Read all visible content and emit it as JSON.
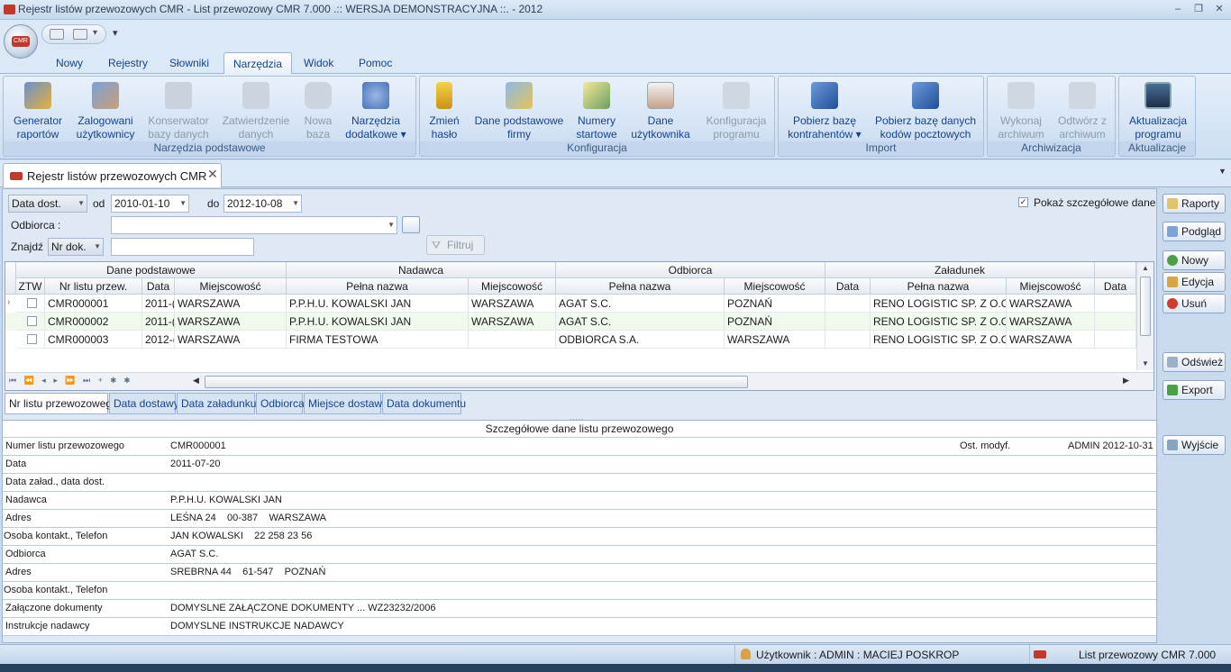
{
  "window": {
    "title": "Rejestr listów przewozowych CMR - List przewozowy CMR 7.000 .:: WERSJA DEMONSTRACYJNA ::. - 2012",
    "minimize": "–",
    "maximize": "❐",
    "close": "✕"
  },
  "orb_label": "CMR",
  "qat_more": "▾",
  "ribbon_tabs": [
    "Nowy",
    "Rejestry",
    "Słowniki",
    "Narzędzia",
    "Widok",
    "Pomoc"
  ],
  "ribbon": {
    "groups": [
      {
        "label": "Narzędzia podstawowe",
        "buttons": [
          {
            "l1": "Generator",
            "l2": "raportów"
          },
          {
            "l1": "Zalogowani",
            "l2": "użytkownicy"
          },
          {
            "l1": "Konserwator",
            "l2": "bazy danych"
          },
          {
            "l1": "Zatwierdzenie",
            "l2": "danych"
          },
          {
            "l1": "Nowa",
            "l2": "baza"
          },
          {
            "l1": "Narzędzia",
            "l2": "dodatkowe ▾"
          }
        ]
      },
      {
        "label": "Konfiguracja",
        "buttons": [
          {
            "l1": "Zmień",
            "l2": "hasło"
          },
          {
            "l1": "Dane podstawowe",
            "l2": "firmy"
          },
          {
            "l1": "Numery",
            "l2": "startowe"
          },
          {
            "l1": "Dane",
            "l2": "użytkownika"
          },
          {
            "l1": "Konfiguracja",
            "l2": "programu"
          }
        ]
      },
      {
        "label": "Import",
        "buttons": [
          {
            "l1": "Pobierz bazę",
            "l2": "kontrahentów ▾"
          },
          {
            "l1": "Pobierz bazę danych",
            "l2": "kodów pocztowych"
          }
        ]
      },
      {
        "label": "Archiwizacja",
        "buttons": [
          {
            "l1": "Wykonaj",
            "l2": "archiwum"
          },
          {
            "l1": "Odtwórz z",
            "l2": "archiwum"
          }
        ]
      },
      {
        "label": "Aktualizacje",
        "buttons": [
          {
            "l1": "Aktualizacja",
            "l2": "programu"
          }
        ]
      }
    ]
  },
  "doc_tab": {
    "title": "Rejestr listów przewozowych CMR",
    "close": "✕"
  },
  "filters": {
    "date_type": "Data dost.",
    "from_label": "od",
    "from_value": "2010-01-10",
    "to_label": "do",
    "to_value": "2012-10-08",
    "show_details_label": "Pokaż szczegółowe dane",
    "recipient_label": "Odbiorca :",
    "recipient_value": "",
    "find_label": "Znajdź",
    "find_field": "Nr dok.",
    "find_value": "",
    "filter_button": "Filtruj"
  },
  "grid": {
    "groups": [
      "Dane podstawowe",
      "Nadawca",
      "Odbiorca",
      "Załadunek"
    ],
    "columns": [
      "ZTW",
      "Nr listu przew.",
      "Data",
      "Miejscowość",
      "Pełna nazwa",
      "Miejscowość",
      "Pełna nazwa",
      "Miejscowość",
      "Data",
      "Pełna nazwa",
      "Miejscowość",
      "Data"
    ],
    "rows": [
      [
        "",
        "CMR000001",
        "2011-(",
        "WARSZAWA",
        "P.P.H.U. KOWALSKI JAN",
        "WARSZAWA",
        "AGAT S.C.",
        "POZNAŃ",
        "",
        "RENO LOGISTIC SP. Z O.O.",
        "WARSZAWA",
        ""
      ],
      [
        "",
        "CMR000002",
        "2011-(",
        "WARSZAWA",
        "P.P.H.U. KOWALSKI JAN",
        "WARSZAWA",
        "AGAT S.C.",
        "POZNAŃ",
        "",
        "RENO LOGISTIC SP. Z O.O.",
        "WARSZAWA",
        ""
      ],
      [
        "",
        "CMR000003",
        "2012-(",
        "WARSZAWA",
        "FIRMA TESTOWA",
        "",
        "ODBIORCA S.A.",
        "WARSZAWA",
        "",
        "RENO LOGISTIC SP. Z O.O.",
        "WARSZAWA",
        ""
      ]
    ],
    "nav": "⏮ ⏪ ◂ ▸ ⏩ ⏭ + ✱ ✱"
  },
  "bottom_tabs": [
    "Nr listu przewozowego",
    "Data dostawy",
    "Data załadunku",
    "Odbiorca",
    "Miejsce dostawy",
    "Data dokumentu"
  ],
  "detail": {
    "header": "Szczegółowe dane listu przewozowego",
    "modified_label": "Ost. modyf.",
    "modified_value": "ADMIN 2012-10-31",
    "rows": [
      {
        "k": "Numer listu przewozowego",
        "v": "CMR000001"
      },
      {
        "k": "Data",
        "v": "2011-07-20"
      },
      {
        "k": "Data załad., data dost.",
        "v": ""
      },
      {
        "k": "Nadawca",
        "v": "P.P.H.U. KOWALSKI JAN"
      },
      {
        "k": "Adres",
        "v": "LEŚNA 24    00-387    WARSZAWA"
      },
      {
        "k": "Osoba kontakt., Telefon",
        "v": "JAN KOWALSKI    22 258 23 56"
      },
      {
        "k": "Odbiorca",
        "v": "AGAT S.C."
      },
      {
        "k": "Adres",
        "v": "SREBRNA 44    61-547    POZNAŃ"
      },
      {
        "k": "Osoba kontakt., Telefon",
        "v": ""
      },
      {
        "k": "Załączone dokumenty",
        "v": "DOMYSLNE ZAŁĄCZONE DOKUMENTY ... WZ23232/2006"
      },
      {
        "k": "Instrukcje nadawcy",
        "v": "DOMYSLNE INSTRUKCJE NADAWCY"
      }
    ]
  },
  "side_buttons": [
    "Raporty",
    "Podgląd",
    "Nowy",
    "Edycja",
    "Usuń",
    "Odśwież",
    "Export",
    "Wyjście"
  ],
  "status": {
    "user": "Użytkownik : ADMIN : MACIEJ POSKROP",
    "app": "List przewozowy CMR 7.000"
  },
  "colors": {
    "accent": "#15428b",
    "ribbon_bg": "#dbe8f6",
    "brand": "#c0392b"
  }
}
